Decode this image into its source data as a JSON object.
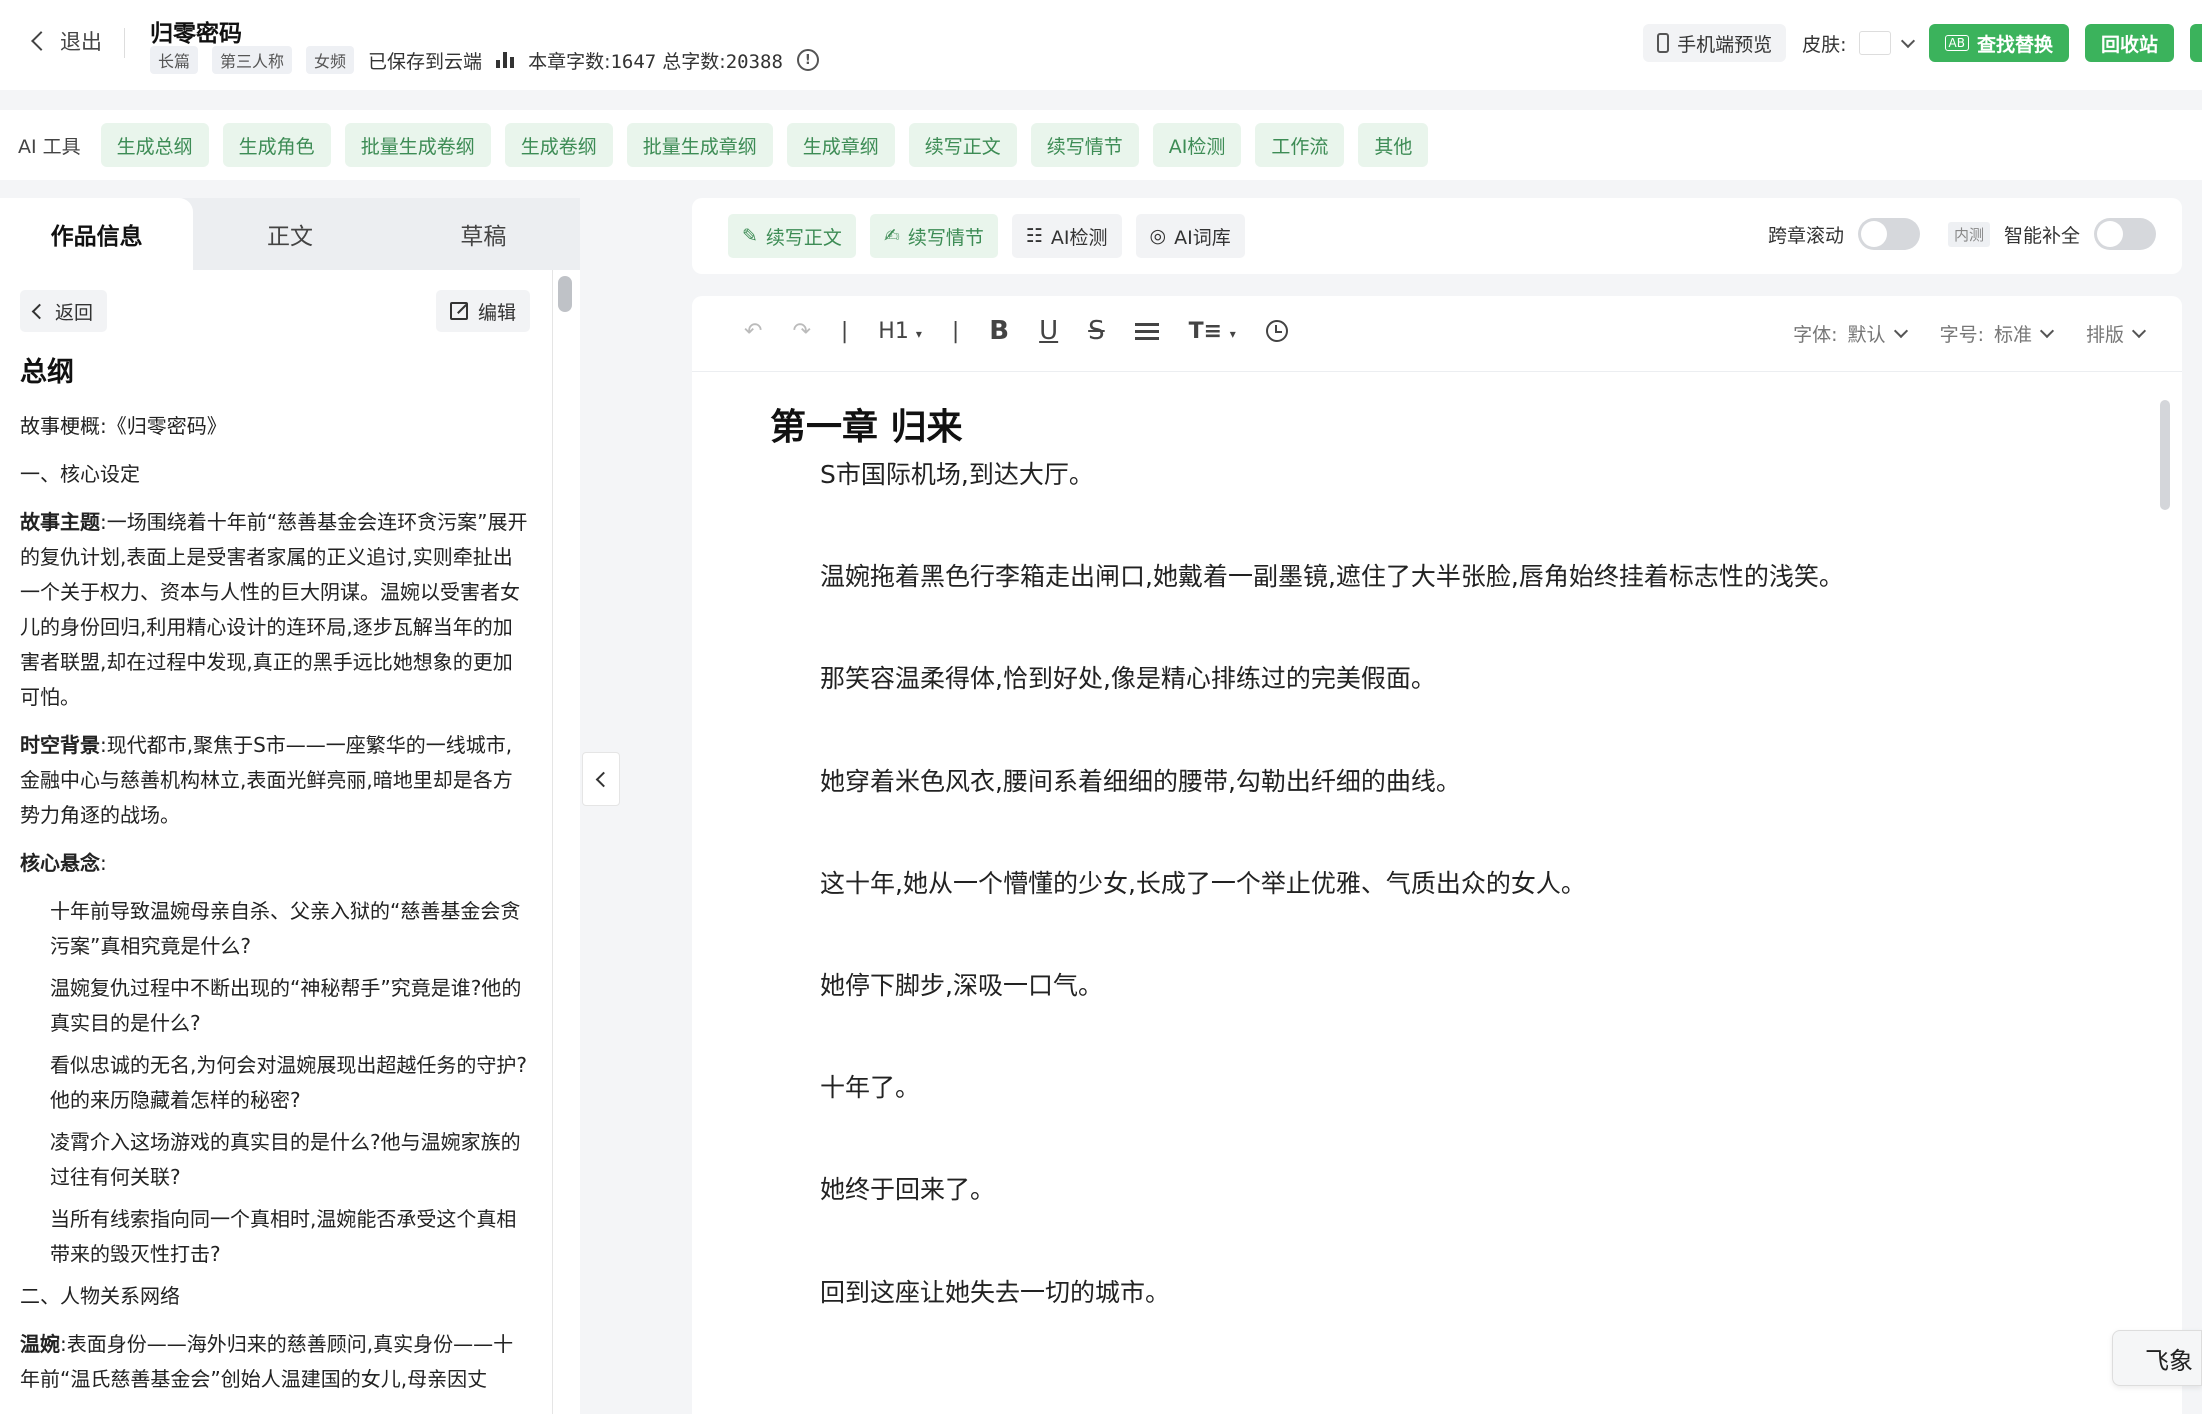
{
  "header": {
    "back_label": "退出",
    "title": "归零密码",
    "tags": [
      "长篇",
      "第三人称",
      "女频"
    ],
    "save_status": "已保存到云端",
    "chapter_words_label": "本章字数:",
    "chapter_words": "1647",
    "total_words_label": "总字数:",
    "total_words": "20388",
    "info_icon": "!",
    "mobile_preview_label": "手机端预览",
    "skin_label": "皮肤:",
    "find_replace_label": "查找替换",
    "find_replace_icon": "AB",
    "recycle_label": "回收站"
  },
  "ai_tools": {
    "label": "AI 工具",
    "items": [
      "生成总纲",
      "生成角色",
      "批量生成卷纲",
      "生成卷纲",
      "批量生成章纲",
      "生成章纲",
      "续写正文",
      "续写情节",
      "AI检测",
      "工作流",
      "其他"
    ]
  },
  "left_panel": {
    "tabs": [
      "作品信息",
      "正文",
      "草稿"
    ],
    "back_label": "返回",
    "edit_label": "编辑",
    "heading": "总纲",
    "synopsis": "故事梗概:《归零密码》",
    "section1": "一、核心设定",
    "theme_label": "故事主题",
    "theme_text": ":一场围绕着十年前“慈善基金会连环贪污案”展开的复仇计划,表面上是受害者家属的正义追讨,实则牵扯出一个关于权力、资本与人性的巨大阴谋。温婉以受害者女儿的身份回归,利用精心设计的连环局,逐步瓦解当年的加害者联盟,却在过程中发现,真正的黑手远比她想象的更加可怕。",
    "setting_label": "时空背景",
    "setting_text": ":现代都市,聚焦于S市——一座繁华的一线城市,金融中心与慈善机构林立,表面光鲜亮丽,暗地里却是各方势力角逐的战场。",
    "suspense_label": "核心悬念",
    "suspense_colon": ":",
    "questions": [
      "十年前导致温婉母亲自杀、父亲入狱的“慈善基金会贪污案”真相究竟是什么?",
      "温婉复仇过程中不断出现的“神秘帮手”究竟是谁?他的真实目的是什么?",
      "看似忠诚的无名,为何会对温婉展现出超越任务的守护?他的来历隐藏着怎样的秘密?",
      "凌霄介入这场游戏的真实目的是什么?他与温婉家族的过往有何关联?",
      "当所有线索指向同一个真相时,温婉能否承受这个真相带来的毁灭性打击?"
    ],
    "section2": "二、人物关系网络",
    "char_label": "温婉",
    "char_text": ":表面身份——海外归来的慈善顾问,真实身份——十年前“温氏慈善基金会”创始人温建国的女儿,母亲因丈"
  },
  "editor_toolbar": {
    "continue_text": "续写正文",
    "continue_plot": "续写情节",
    "ai_detect": "AI检测",
    "ai_lexicon": "AI词库",
    "cross_scroll": "跨章滚动",
    "beta": "内测",
    "smart_fill": "智能补全"
  },
  "format_bar": {
    "heading_level": "H1",
    "font_label": "字体:",
    "font_value": "默认",
    "size_label": "字号:",
    "size_value": "标准",
    "layout_label": "排版"
  },
  "document": {
    "chapter_title": "第一章 归来",
    "paragraphs": [
      "S市国际机场,到达大厅。",
      "温婉拖着黑色行李箱走出闸口,她戴着一副墨镜,遮住了大半张脸,唇角始终挂着标志性的浅笑。",
      "那笑容温柔得体,恰到好处,像是精心排练过的完美假面。",
      "她穿着米色风衣,腰间系着细细的腰带,勾勒出纤细的曲线。",
      "这十年,她从一个懵懂的少女,长成了一个举止优雅、气质出众的女人。",
      "她停下脚步,深吸一口气。",
      "十年了。",
      "她终于回来了。",
      "回到这座让她失去一切的城市。"
    ]
  },
  "floating": {
    "feishu_label": "飞象"
  }
}
